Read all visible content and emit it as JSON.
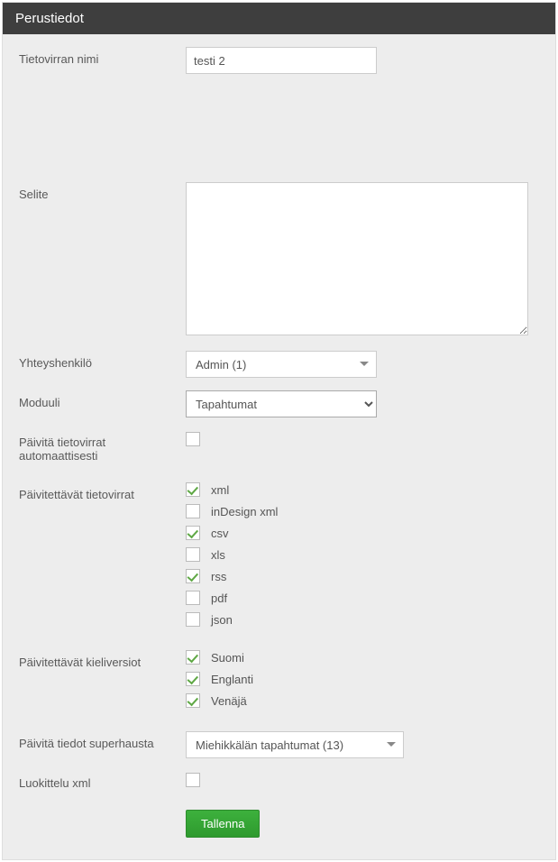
{
  "panel": {
    "title": "Perustiedot"
  },
  "fields": {
    "name": {
      "label": "Tietovirran nimi",
      "value": "testi 2"
    },
    "description": {
      "label": "Selite",
      "value": ""
    },
    "contact": {
      "label": "Yhteyshenkilö",
      "selected": "Admin (1)"
    },
    "module": {
      "label": "Moduuli",
      "selected": "Tapahtumat"
    },
    "autoupdate": {
      "label": "Päivitä tietovirrat automaattisesti",
      "checked": false
    },
    "formats": {
      "label": "Päivitettävät tietovirrat",
      "items": [
        {
          "key": "xml",
          "label": "xml",
          "checked": true
        },
        {
          "key": "indesign",
          "label": "inDesign xml",
          "checked": false
        },
        {
          "key": "csv",
          "label": "csv",
          "checked": true
        },
        {
          "key": "xls",
          "label": "xls",
          "checked": false
        },
        {
          "key": "rss",
          "label": "rss",
          "checked": true
        },
        {
          "key": "pdf",
          "label": "pdf",
          "checked": false
        },
        {
          "key": "json",
          "label": "json",
          "checked": false
        }
      ]
    },
    "languages": {
      "label": "Päivitettävät kieliversiot",
      "items": [
        {
          "key": "fi",
          "label": "Suomi",
          "checked": true
        },
        {
          "key": "en",
          "label": "Englanti",
          "checked": true
        },
        {
          "key": "ru",
          "label": "Venäjä",
          "checked": true
        }
      ]
    },
    "supersearch": {
      "label": "Päivitä tiedot superhausta",
      "selected": "Miehikkälän tapahtumat (13)"
    },
    "classify": {
      "label": "Luokittelu xml",
      "checked": false
    }
  },
  "actions": {
    "save": "Tallenna"
  }
}
